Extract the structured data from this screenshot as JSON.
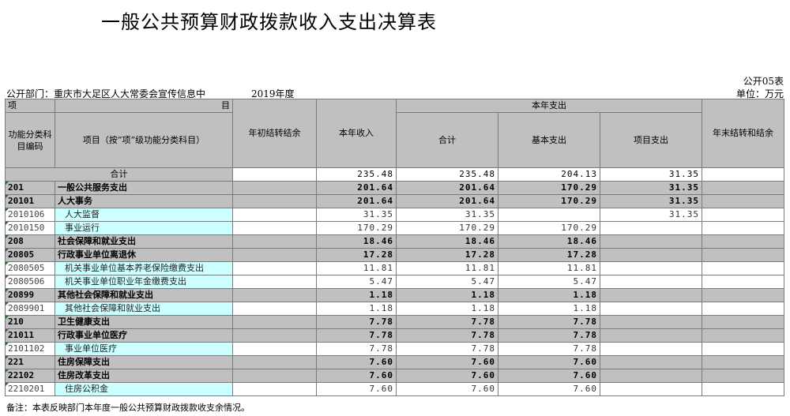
{
  "title": "一般公共预算财政拨款收入支出决算表",
  "form_no": "公开05表",
  "dept": "公开部门：重庆市大足区人大常委会宣传信息中",
  "year": "2019年度",
  "unit": "单位：万元",
  "headers": {
    "item": "项",
    "item_end": "目",
    "code": "功能分类科目编码",
    "name": "项目（按“项”级功能分类科目）",
    "begin_balance": "年初结转结余",
    "income": "本年收入",
    "expense_group": "本年支出",
    "total": "合计",
    "basic": "基本支出",
    "project": "项目支出",
    "end_balance": "年末结转和结余"
  },
  "summary": {
    "label": "合计",
    "begin_balance": "",
    "income": "235.48",
    "total": "235.48",
    "basic": "204.13",
    "project": "31.35",
    "end_balance": ""
  },
  "rows": [
    {
      "code": "201",
      "name": "一般公共服务支出",
      "income": "201.64",
      "total": "201.64",
      "basic": "170.29",
      "project": "31.35"
    },
    {
      "code": "20101",
      "name": "人大事务",
      "income": "201.64",
      "total": "201.64",
      "basic": "170.29",
      "project": "31.35"
    },
    {
      "code": "2010106",
      "name": "人大监督",
      "income": "31.35",
      "total": "31.35",
      "basic": "",
      "project": "31.35"
    },
    {
      "code": "2010150",
      "name": "事业运行",
      "income": "170.29",
      "total": "170.29",
      "basic": "170.29",
      "project": ""
    },
    {
      "code": "208",
      "name": "社会保障和就业支出",
      "income": "18.46",
      "total": "18.46",
      "basic": "18.46",
      "project": ""
    },
    {
      "code": "20805",
      "name": "行政事业单位离退休",
      "income": "17.28",
      "total": "17.28",
      "basic": "17.28",
      "project": ""
    },
    {
      "code": "2080505",
      "name": "机关事业单位基本养老保险缴费支出",
      "income": "11.81",
      "total": "11.81",
      "basic": "11.81",
      "project": ""
    },
    {
      "code": "2080506",
      "name": "机关事业单位职业年金缴费支出",
      "income": "5.47",
      "total": "5.47",
      "basic": "5.47",
      "project": ""
    },
    {
      "code": "20899",
      "name": "其他社会保障和就业支出",
      "income": "1.18",
      "total": "1.18",
      "basic": "1.18",
      "project": ""
    },
    {
      "code": "2089901",
      "name": "其他社会保障和就业支出",
      "income": "1.18",
      "total": "1.18",
      "basic": "1.18",
      "project": ""
    },
    {
      "code": "210",
      "name": "卫生健康支出",
      "income": "7.78",
      "total": "7.78",
      "basic": "7.78",
      "project": ""
    },
    {
      "code": "21011",
      "name": "行政事业单位医疗",
      "income": "7.78",
      "total": "7.78",
      "basic": "7.78",
      "project": ""
    },
    {
      "code": "2101102",
      "name": "事业单位医疗",
      "income": "7.78",
      "total": "7.78",
      "basic": "7.78",
      "project": ""
    },
    {
      "code": "221",
      "name": "住房保障支出",
      "income": "7.60",
      "total": "7.60",
      "basic": "7.60",
      "project": ""
    },
    {
      "code": "22102",
      "name": "住房改革支出",
      "income": "7.60",
      "total": "7.60",
      "basic": "7.60",
      "project": ""
    },
    {
      "code": "2210201",
      "name": "住房公积金",
      "income": "7.60",
      "total": "7.60",
      "basic": "7.60",
      "project": ""
    }
  ],
  "note": "备注：本表反映部门本年度一般公共预算财政拨款收支余情况。"
}
